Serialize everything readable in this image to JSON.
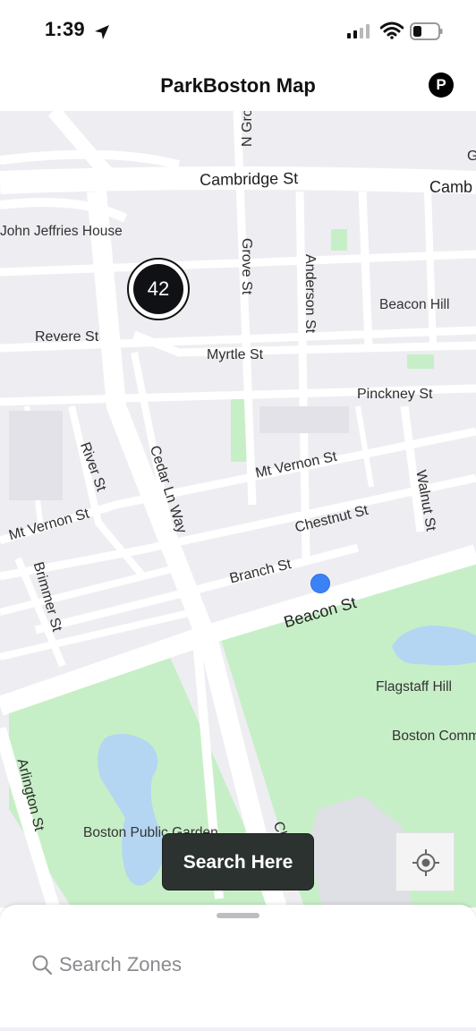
{
  "status_bar": {
    "time": "1:39"
  },
  "nav": {
    "title": "ParkBoston Map",
    "parking_badge": "P"
  },
  "map": {
    "cluster_count": "42",
    "labels": {
      "cambridge_st": "Cambridge St",
      "cambridge_st_partial": "Camb",
      "n_grove_st": "N Grov",
      "g_partial": "G",
      "john_jeffries": "John Jeffries House",
      "grove_st": "Grove St",
      "anderson_st": "Anderson St",
      "beacon_hill": "Beacon Hill",
      "revere_st": "Revere St",
      "myrtle_st": "Myrtle St",
      "pinckney_st": "Pinckney St",
      "mt_vernon_st_e": "Mt Vernon St",
      "mt_vernon_st_w": "Mt Vernon St",
      "river_st": "River St",
      "cedar_ln_way": "Cedar Ln Way",
      "chestnut_st": "Chestnut St",
      "walnut_st": "Walnut St",
      "brimmer_st": "Brimmer St",
      "branch_st": "Branch St",
      "beacon_st": "Beacon St",
      "flagstaff_hill": "Flagstaff Hill",
      "boston_common": "Boston Comm",
      "arlington_st": "Arlington St",
      "boston_public_garden": "Boston Public Garden",
      "charles_st": "Charl"
    }
  },
  "actions": {
    "search_here": "Search Here"
  },
  "sheet": {
    "search_placeholder": "Search Zones"
  },
  "colors": {
    "map_bg": "#eeeef2",
    "park_green": "#c7efc7",
    "water": "#b4d6f2",
    "user_dot": "#3b82f6",
    "search_here_bg": "#2b3230"
  }
}
